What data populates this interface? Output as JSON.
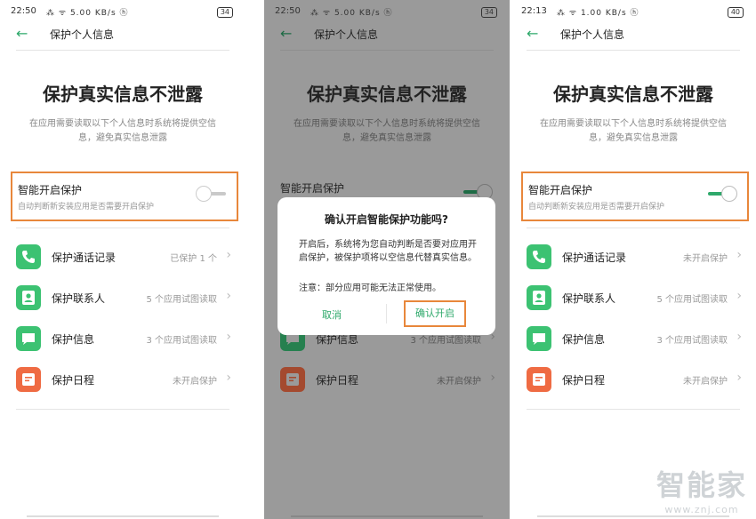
{
  "panels": [
    {
      "status": {
        "time": "22:50",
        "icons": "⁂ ᯤ 5.00 KB/s ⓗ",
        "battery": "34"
      },
      "title": "保护个人信息",
      "headline": "保护真实信息不泄露",
      "description": "在应用需要读取以下个人信息时系统将提供空信息，避免真实信息泄露",
      "smart": {
        "title": "智能开启保护",
        "subtitle": "自动判断新安装应用是否需要开启保护"
      },
      "items": [
        {
          "label": "保护通话记录",
          "status": "已保护 1 个"
        },
        {
          "label": "保护联系人",
          "status": "5 个应用试图读取"
        },
        {
          "label": "保护信息",
          "status": "3 个应用试图读取"
        },
        {
          "label": "保护日程",
          "status": "未开启保护"
        }
      ]
    },
    {
      "status": {
        "time": "22:50",
        "icons": "⁂ ᯤ 5.00 KB/s ⓗ",
        "battery": "34"
      },
      "title": "保护个人信息",
      "headline": "保护真实信息不泄露",
      "description": "在应用需要读取以下个人信息时系统将提供空信息，避免真实信息泄露",
      "smart": {
        "title": "智能开启保护"
      },
      "items": [
        {
          "label": "保护信息",
          "status": "3 个应用试图读取"
        },
        {
          "label": "保护日程",
          "status": "未开启保护"
        }
      ],
      "dialog": {
        "title": "确认开启智能保护功能吗?",
        "body": "开启后，系统将为您自动判断是否要对应用开启保护，被保护项将以空信息代替真实信息。",
        "note": "注意：部分应用可能无法正常使用。",
        "cancel": "取消",
        "confirm": "确认开启"
      }
    },
    {
      "status": {
        "time": "22:13",
        "icons": "⁂ ᯤ 1.00 KB/s ⓗ",
        "battery": "40"
      },
      "title": "保护个人信息",
      "headline": "保护真实信息不泄露",
      "description": "在应用需要读取以下个人信息时系统将提供空信息，避免真实信息泄露",
      "smart": {
        "title": "智能开启保护",
        "subtitle": "自动判断新安装应用是否需要开启保护"
      },
      "items": [
        {
          "label": "保护通话记录",
          "status": "未开启保护"
        },
        {
          "label": "保护联系人",
          "status": "5 个应用试图读取"
        },
        {
          "label": "保护信息",
          "status": "3 个应用试图读取"
        },
        {
          "label": "保护日程",
          "status": "未开启保护"
        }
      ]
    }
  ],
  "watermark": {
    "brand": "智能家",
    "url": "www.znj.com"
  },
  "colors": {
    "accent": "#2fa96b",
    "highlight": "#e8873b",
    "icon_green": "#3cc272",
    "icon_orange": "#ef6b43",
    "overlay": "#9a9a9a"
  },
  "toggle_states": {
    "panel1": "off",
    "panel3": "on"
  },
  "icons": [
    "back-arrow-icon",
    "phone-icon",
    "contact-icon",
    "message-icon",
    "calendar-icon",
    "chevron-right-icon"
  ]
}
